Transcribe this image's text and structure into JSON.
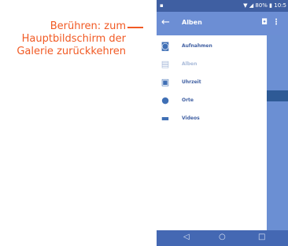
{
  "callout": {
    "lines": [
      "Berühren: zum",
      "Hauptbildschirm der",
      "Galerie zurückkehren"
    ],
    "color": "#f15a24"
  },
  "status_bar": {
    "battery": "80%",
    "time": "10:5"
  },
  "app_bar": {
    "title": "Alben",
    "back_icon": "back-arrow-icon",
    "camera_icon": "camera-icon",
    "more_icon": "more-vert-icon"
  },
  "drawer": {
    "items": [
      {
        "label": "Aufnahmen",
        "icon": "camera-icon",
        "active": true
      },
      {
        "label": "Alben",
        "icon": "albums-icon",
        "active": false
      },
      {
        "label": "Uhrzeit",
        "icon": "calendar-icon",
        "active": true
      },
      {
        "label": "Orte",
        "icon": "location-pin-icon",
        "active": true
      },
      {
        "label": "Videos",
        "icon": "video-icon",
        "active": true
      }
    ]
  },
  "nav_bar": {
    "back_icon": "nav-back-icon",
    "home_icon": "nav-home-icon",
    "recents_icon": "nav-recents-icon"
  },
  "colors": {
    "status_bar": "#3f5fa2",
    "app_bar": "#6c8ed4",
    "nav_bar": "#4468b3",
    "accent": "#3f6fb5"
  }
}
